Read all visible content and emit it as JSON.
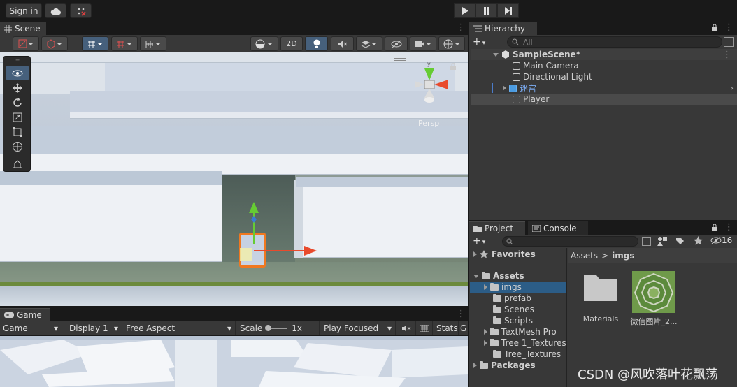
{
  "toolbar": {
    "sign_in_label": "Sign in",
    "cloud_icon": "cloud-icon",
    "collab_icon": "collab-icon",
    "play_icon": "▶",
    "pause_icon": "❚❚",
    "step_icon": "▶❙"
  },
  "scene": {
    "tab_label": "Scene",
    "mode_2d_label": "2D",
    "persp_label": "Persp"
  },
  "game": {
    "tab_label": "Game",
    "game_select": "Game",
    "display_select": "Display 1",
    "aspect_select": "Free Aspect",
    "scale_label": "Scale",
    "scale_value": "1x",
    "play_focused_select": "Play Focused",
    "stats_label": "Stats",
    "gizmos_label": "G"
  },
  "hierarchy": {
    "tab_label": "Hierarchy",
    "search_placeholder": "All",
    "scene_name": "SampleScene*",
    "items": [
      {
        "label": "Main Camera"
      },
      {
        "label": "Directional Light"
      },
      {
        "label": "迷宫"
      },
      {
        "label": "Player"
      }
    ]
  },
  "project": {
    "tab_label": "Project",
    "console_tab_label": "Console",
    "hidden_count": "16",
    "favorites_label": "Favorites",
    "assets_label": "Assets",
    "folders": [
      {
        "label": "imgs"
      },
      {
        "label": "prefab"
      },
      {
        "label": "Scenes"
      },
      {
        "label": "Scripts"
      },
      {
        "label": "TextMesh Pro"
      },
      {
        "label": "Tree 1_Textures"
      },
      {
        "label": "Tree_Textures"
      }
    ],
    "packages_label": "Packages",
    "breadcrumb_root": "Assets",
    "breadcrumb_sep": ">",
    "breadcrumb_current": "imgs",
    "grid_items": [
      {
        "label": "Materials"
      },
      {
        "label": "微信图片_2..."
      }
    ]
  },
  "watermark": "CSDN @风吹落叶花飘荡",
  "colors": {
    "accent_blue": "#4b7bc8",
    "selection": "#2c5d87",
    "gizmo_green": "#66cc33",
    "gizmo_red": "#e84a2c",
    "gizmo_blue": "#3a7bd5",
    "selection_orange": "#f07820"
  }
}
